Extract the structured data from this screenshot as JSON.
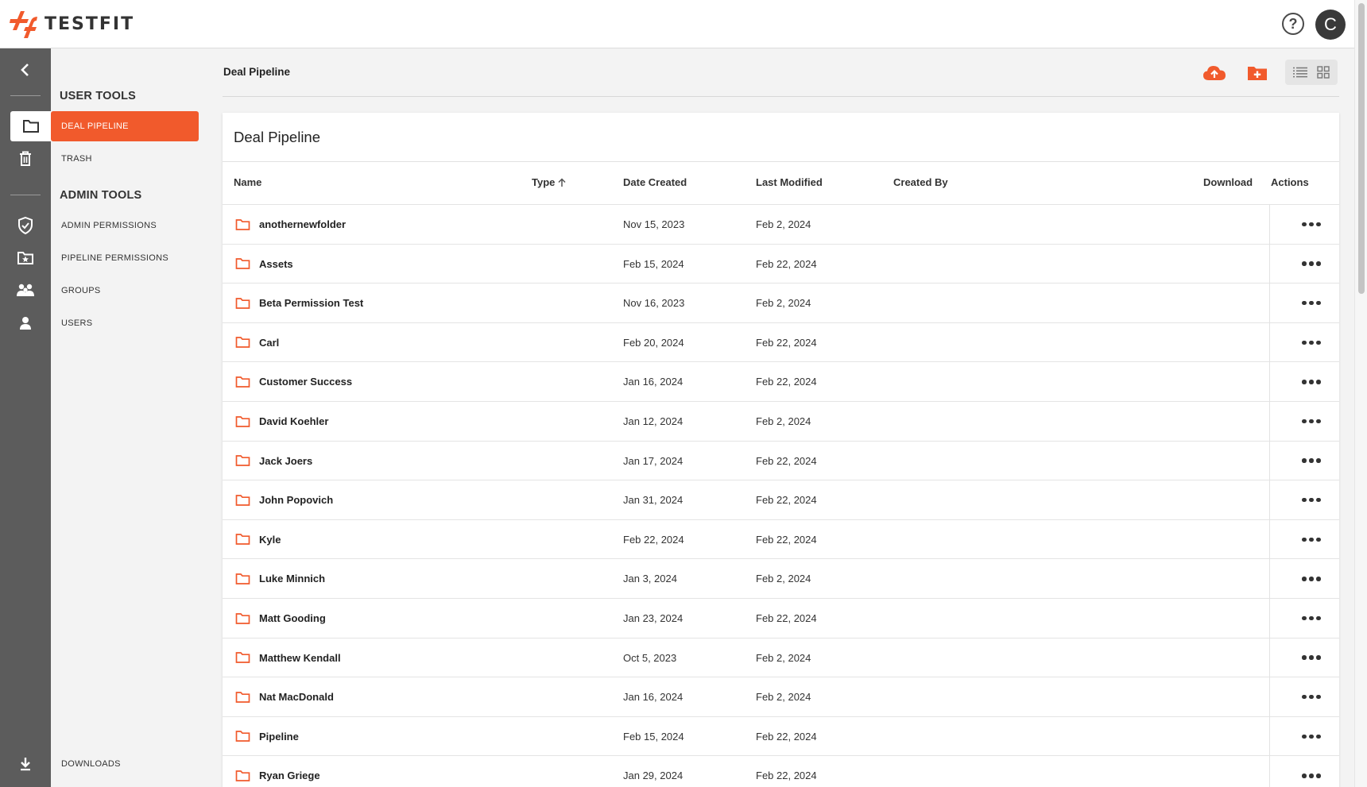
{
  "app": {
    "logo_text": "TESTFIT",
    "help_icon": "help-circle-icon",
    "help_glyph": "?",
    "user_initial": "C"
  },
  "rail": {
    "icons": [
      "chevron-left-icon",
      "folder-icon",
      "trash-icon",
      "shield-check-icon",
      "folder-star-icon",
      "group-icon",
      "person-icon",
      "download-icon"
    ]
  },
  "menu": {
    "user_tools_heading": "USER TOOLS",
    "deal_pipeline": "DEAL PIPELINE",
    "trash": "TRASH",
    "admin_tools_heading": "ADMIN TOOLS",
    "admin_permissions": "ADMIN PERMISSIONS",
    "pipeline_permissions": "PIPELINE PERMISSIONS",
    "groups": "GROUPS",
    "users": "USERS",
    "downloads": "DOWNLOADS"
  },
  "header": {
    "breadcrumb": "Deal Pipeline",
    "upload_icon": "cloud-upload-icon",
    "new_folder_icon": "folder-plus-icon",
    "list_view_icon": "list-view-icon",
    "grid_view_icon": "grid-view-icon"
  },
  "table": {
    "title": "Deal Pipeline",
    "columns": {
      "name": "Name",
      "type": "Type",
      "date_created": "Date Created",
      "last_modified": "Last Modified",
      "created_by": "Created By",
      "download": "Download",
      "actions": "Actions"
    },
    "sort_icon": "arrow-up-icon",
    "rows": [
      {
        "name": "anothernewfolder",
        "created": "Nov 15, 2023",
        "modified": "Feb 2, 2024"
      },
      {
        "name": "Assets",
        "created": "Feb 15, 2024",
        "modified": "Feb 22, 2024"
      },
      {
        "name": "Beta Permission Test",
        "created": "Nov 16, 2023",
        "modified": "Feb 2, 2024"
      },
      {
        "name": "Carl",
        "created": "Feb 20, 2024",
        "modified": "Feb 22, 2024"
      },
      {
        "name": "Customer Success",
        "created": "Jan 16, 2024",
        "modified": "Feb 22, 2024"
      },
      {
        "name": "David Koehler",
        "created": "Jan 12, 2024",
        "modified": "Feb 2, 2024"
      },
      {
        "name": "Jack Joers",
        "created": "Jan 17, 2024",
        "modified": "Feb 22, 2024"
      },
      {
        "name": "John Popovich",
        "created": "Jan 31, 2024",
        "modified": "Feb 22, 2024"
      },
      {
        "name": "Kyle",
        "created": "Feb 22, 2024",
        "modified": "Feb 22, 2024"
      },
      {
        "name": "Luke Minnich",
        "created": "Jan 3, 2024",
        "modified": "Feb 2, 2024"
      },
      {
        "name": "Matt Gooding",
        "created": "Jan 23, 2024",
        "modified": "Feb 22, 2024"
      },
      {
        "name": "Matthew Kendall",
        "created": "Oct 5, 2023",
        "modified": "Feb 2, 2024"
      },
      {
        "name": "Nat MacDonald",
        "created": "Jan 16, 2024",
        "modified": "Feb 2, 2024"
      },
      {
        "name": "Pipeline",
        "created": "Feb 15, 2024",
        "modified": "Feb 22, 2024"
      },
      {
        "name": "Ryan Griege",
        "created": "Jan 29, 2024",
        "modified": "Feb 22, 2024"
      }
    ]
  },
  "colors": {
    "accent": "#f15a2c",
    "rail_bg": "#5c5c5c",
    "page_bg": "#f3f3f3"
  }
}
